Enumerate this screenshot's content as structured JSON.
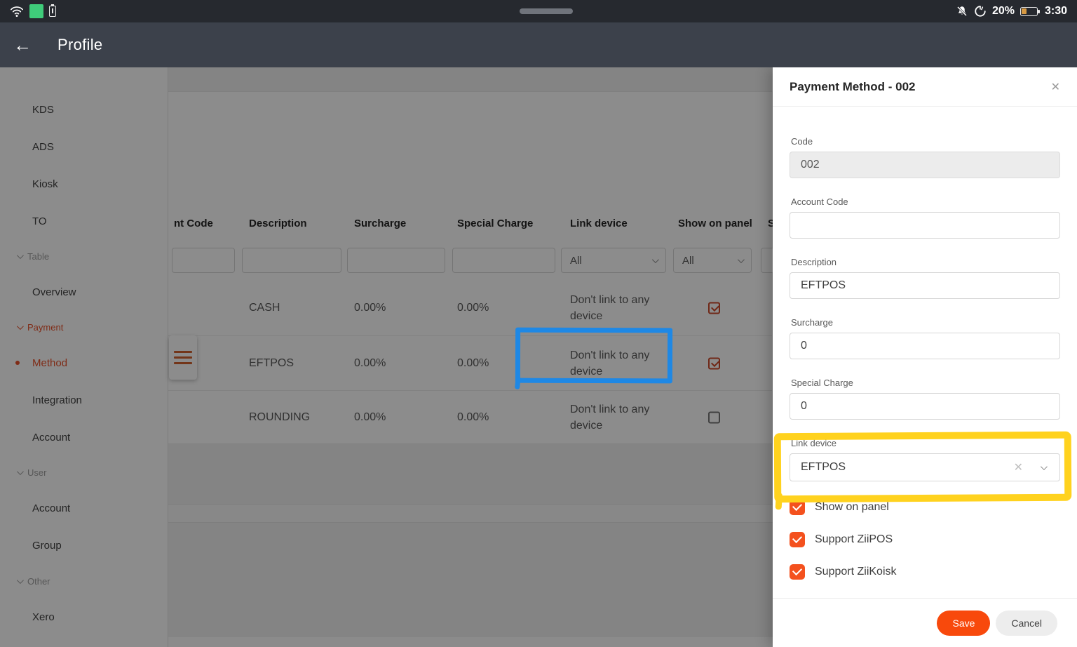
{
  "status_bar": {
    "time": "3:30",
    "battery_percent": "20%",
    "left_icons": [
      "wifi-icon",
      "green-app-chip",
      "mini-battery-icon"
    ],
    "right_icons": [
      "notifications-off-icon",
      "data-saver-icon",
      "battery-icon"
    ]
  },
  "app_bar": {
    "title": "Profile",
    "back_icon": "←"
  },
  "sidebar": {
    "entries": [
      {
        "label": "KDS",
        "type": "item"
      },
      {
        "label": "ADS",
        "type": "item"
      },
      {
        "label": "Kiosk",
        "type": "item"
      },
      {
        "label": "TO",
        "type": "item"
      },
      {
        "label": "Table",
        "type": "section"
      },
      {
        "label": "Overview",
        "type": "item"
      },
      {
        "label": "Payment",
        "type": "section",
        "active": true
      },
      {
        "label": "Method",
        "type": "item",
        "active": true
      },
      {
        "label": "Integration",
        "type": "item"
      },
      {
        "label": "Account",
        "type": "item"
      },
      {
        "label": "User",
        "type": "section"
      },
      {
        "label": "Account",
        "type": "item"
      },
      {
        "label": "Group",
        "type": "item"
      },
      {
        "label": "Other",
        "type": "section"
      },
      {
        "label": "Xero",
        "type": "item"
      }
    ]
  },
  "table": {
    "headers": {
      "account_code_truncated": "nt Code",
      "description": "Description",
      "surcharge": "Surcharge",
      "special_charge": "Special Charge",
      "link_device": "Link device",
      "show_on_panel": "Show on panel",
      "next_truncated": "S"
    },
    "filters": {
      "link_device": "All",
      "show_on_panel": "All"
    },
    "rows": [
      {
        "description": "CASH",
        "surcharge": "0.00%",
        "special_charge": "0.00%",
        "link_device": "Don't link to any device",
        "show_on_panel": true
      },
      {
        "description": "EFTPOS",
        "surcharge": "0.00%",
        "special_charge": "0.00%",
        "link_device": "Don't link to any device",
        "show_on_panel": true
      },
      {
        "description": "ROUNDING",
        "surcharge": "0.00%",
        "special_charge": "0.00%",
        "link_device": "Don't link to any device",
        "show_on_panel": false
      }
    ]
  },
  "panel": {
    "title": "Payment Method - 002",
    "close_icon": "✕",
    "fields": {
      "code": {
        "label": "Code",
        "value": "002",
        "disabled": true
      },
      "account_code": {
        "label": "Account Code",
        "value": ""
      },
      "description": {
        "label": "Description",
        "value": "EFTPOS"
      },
      "surcharge": {
        "label": "Surcharge",
        "value": "0"
      },
      "special_charge": {
        "label": "Special Charge",
        "value": "0"
      },
      "link_device": {
        "label": "Link device",
        "value": "EFTPOS",
        "clear_icon": "✕"
      }
    },
    "checkboxes": [
      {
        "label": "Show on panel",
        "checked": true
      },
      {
        "label": "Support ZiiPOS",
        "checked": true
      },
      {
        "label": "Support ZiiKoisk",
        "checked": true
      }
    ],
    "footer": {
      "save": "Save",
      "cancel": "Cancel"
    }
  },
  "colors": {
    "accent_orange": "#f4511e",
    "save_button": "#f8490c",
    "app_bar": "#3c414b",
    "status_bar": "#26292f",
    "annotation_blue": "#1e88e5",
    "annotation_yellow": "#ffd21e",
    "battery_fill": "#d79a43"
  }
}
